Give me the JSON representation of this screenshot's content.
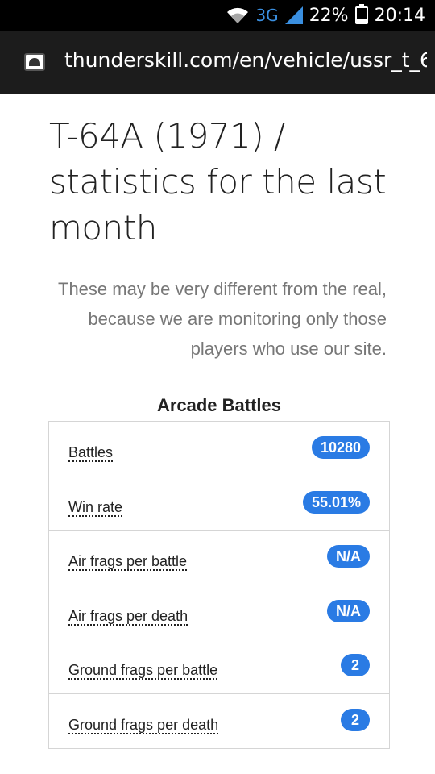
{
  "status_bar": {
    "network": "3G",
    "battery": "22%",
    "battery_level": 0.22,
    "time": "20:14"
  },
  "browser": {
    "url": "thunderskill.com/en/vehicle/ussr_t_6"
  },
  "page": {
    "title_lines": [
      "T-64A (1971) /",
      "statistics for the last",
      "month"
    ],
    "subtitle_lines": [
      "These may be very different from the real,",
      "because we are monitoring only those",
      "players who use our site."
    ],
    "section_title": "Arcade Battles",
    "stats": [
      {
        "label": "Battles",
        "value": "10280"
      },
      {
        "label": "Win rate",
        "value": "55.01%"
      },
      {
        "label": "Air frags per battle",
        "value": "N/A"
      },
      {
        "label": "Air frags per death",
        "value": "N/A"
      },
      {
        "label": "Ground frags per battle",
        "value": "2"
      },
      {
        "label": "Ground frags per death",
        "value": "2"
      }
    ]
  }
}
